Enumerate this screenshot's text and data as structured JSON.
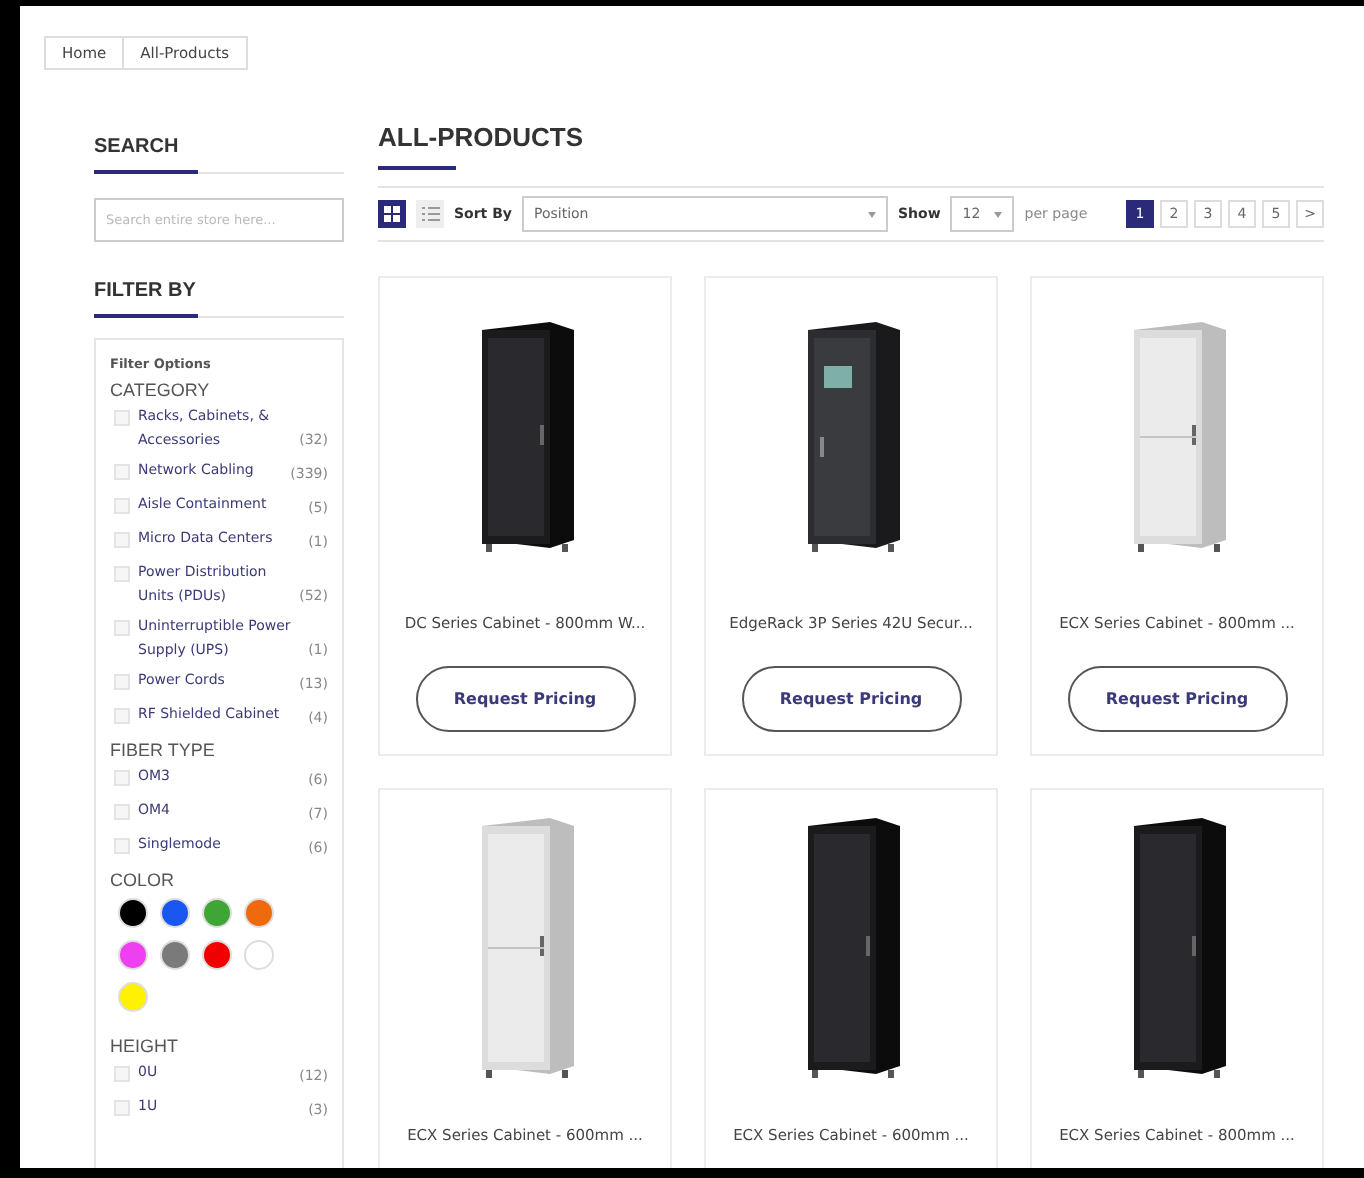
{
  "breadcrumb": [
    {
      "label": "Home"
    },
    {
      "label": "All-Products"
    }
  ],
  "sidebar": {
    "search_title": "SEARCH",
    "search": {
      "placeholder": "Search entire store here..."
    },
    "filter_title": "FILTER BY",
    "filter_options_label": "Filter Options",
    "groups": [
      {
        "title": "CATEGORY",
        "kind": "checklist",
        "items": [
          {
            "label": "Racks, Cabinets, & Accessories",
            "count": "(32)",
            "checked": false
          },
          {
            "label": "Network Cabling",
            "count": "(339)",
            "checked": false
          },
          {
            "label": "Aisle Containment",
            "count": "(5)",
            "checked": false
          },
          {
            "label": "Micro Data Centers",
            "count": "(1)",
            "checked": false
          },
          {
            "label": "Power Distribution Units (PDUs)",
            "count": "(52)",
            "checked": false
          },
          {
            "label": "Uninterruptible Power Supply (UPS)",
            "count": "(1)",
            "checked": false
          },
          {
            "label": "Power Cords",
            "count": "(13)",
            "checked": false
          },
          {
            "label": "RF Shielded Cabinet",
            "count": "(4)",
            "checked": false
          }
        ]
      },
      {
        "title": "FIBER TYPE",
        "kind": "checklist",
        "items": [
          {
            "label": "OM3",
            "count": "(6)",
            "checked": false
          },
          {
            "label": "OM4",
            "count": "(7)",
            "checked": false
          },
          {
            "label": "Singlemode",
            "count": "(6)",
            "checked": false
          }
        ]
      },
      {
        "title": "COLOR",
        "kind": "swatches",
        "items": [
          {
            "color": "#000000"
          },
          {
            "color": "#1a56f0"
          },
          {
            "color": "#3fa535"
          },
          {
            "color": "#ee6a0c"
          },
          {
            "color": "#ee3ff0"
          },
          {
            "color": "#7a7a7a"
          },
          {
            "color": "#f00000"
          },
          {
            "color": "#ffffff"
          },
          {
            "color": "#fff200"
          }
        ]
      },
      {
        "title": "HEIGHT",
        "kind": "checklist",
        "items": [
          {
            "label": "0U",
            "count": "(12)",
            "checked": false
          },
          {
            "label": "1U",
            "count": "(3)",
            "checked": false
          }
        ]
      }
    ]
  },
  "main": {
    "title": "ALL-PRODUCTS",
    "view_modes": [
      {
        "kind": "grid",
        "selected": true
      },
      {
        "kind": "list",
        "selected": false
      }
    ],
    "sort_label": "Sort By",
    "sort_value": "Position",
    "show_label": "Show",
    "show_value": "12",
    "per_page_label": "per page",
    "pages": [
      {
        "label": "1",
        "selected": true
      },
      {
        "label": "2",
        "selected": false
      },
      {
        "label": "3",
        "selected": false
      },
      {
        "label": "4",
        "selected": false
      },
      {
        "label": "5",
        "selected": false
      }
    ],
    "next_page": ">",
    "products": [
      {
        "name": "DC Series Cabinet - 800mm W...",
        "kind": "black",
        "button": "Request Pricing"
      },
      {
        "name": "EdgeRack 3P Series 42U Secur...",
        "kind": "control",
        "button": "Request Pricing"
      },
      {
        "name": "ECX Series Cabinet - 800mm ...",
        "kind": "light",
        "button": "Request Pricing"
      },
      {
        "name": "ECX Series Cabinet - 600mm ...",
        "kind": "light"
      },
      {
        "name": "ECX Series Cabinet - 600mm ...",
        "kind": "black"
      },
      {
        "name": "ECX Series Cabinet - 800mm ...",
        "kind": "black"
      }
    ]
  }
}
